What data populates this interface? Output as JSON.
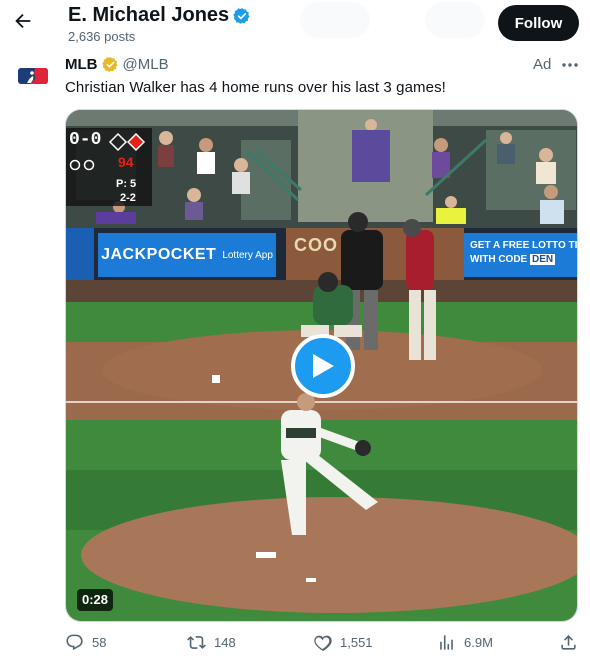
{
  "header": {
    "back_icon": "arrow-left-icon",
    "profile_name": "E. Michael Jones",
    "verified_icon": "verified-badge-icon",
    "posts_count": "2,636 posts",
    "follow_label": "Follow"
  },
  "tweet": {
    "avatar_icon": "mlb-logo-icon",
    "author": "MLB",
    "gold_badge_icon": "gold-verified-badge-icon",
    "handle": "@MLB",
    "ad_label": "Ad",
    "more_icon": "more-icon",
    "text": "Christian Walker has 4 home runs over his last 3 games!",
    "video": {
      "play_icon": "play-icon",
      "duration": "0:28",
      "scorebug": {
        "score": "0-0",
        "pitch_count": "94",
        "pitcher_pitches": "P: 5",
        "count": "2-2"
      },
      "banner_left_big": "JACKPOCKET",
      "banner_left_small": "Lottery App",
      "banner_right_line1": "GET A FREE LOTTO TIC",
      "banner_right_line2": "WITH CODE",
      "banner_right_code": "DEN",
      "stadium_sign": "COO"
    },
    "actions": {
      "replies": "58",
      "retweets": "148",
      "likes": "1,551",
      "views": "6.9M"
    }
  },
  "colors": {
    "accent": "#1d9bf0",
    "text": "#0f1419",
    "secondary_text": "#536471",
    "gold_badge": "#e8b829"
  }
}
